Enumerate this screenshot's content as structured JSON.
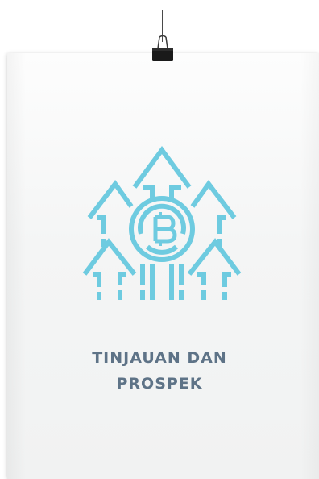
{
  "poster": {
    "title_line1": "TINJAUAN  DAN",
    "title_line2": "PROSPEK"
  },
  "icon": {
    "name": "bitcoin-growth-arrows-icon",
    "color": "#6ecbe0"
  },
  "colors": {
    "title": "#5e7387",
    "poster_bg": "#f3f4f4",
    "clip": "#1a1a1a"
  }
}
